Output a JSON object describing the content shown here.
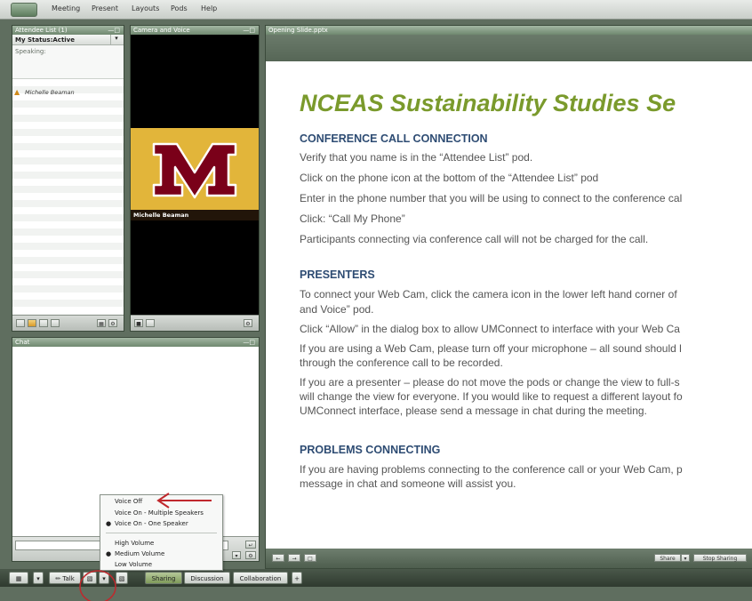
{
  "menubar": {
    "items": [
      "Meeting",
      "Present",
      "Layouts",
      "Pods",
      "Help"
    ]
  },
  "attendee_pod": {
    "title": "Attendee List (1)",
    "status": "My Status:Active",
    "speaking": "Speaking:",
    "attendees": [
      "Michelle Beaman"
    ]
  },
  "camera_pod": {
    "title": "Camera and Voice",
    "name": "Michelle Beaman"
  },
  "slide_pod": {
    "title": "Opening Slide.pptx",
    "slide_title": "NCEAS Sustainability Studies Se",
    "sections": [
      {
        "heading": "CONFERENCE CALL CONNECTION",
        "lines": [
          "Verify that you name is in the “Attendee List” pod.",
          "Click on the phone icon at the bottom of the “Attendee List” pod",
          "Enter in the phone number that you will be using to connect to the conference cal",
          "Click: “Call My Phone”",
          "Participants connecting via conference call will not be charged for the call."
        ]
      },
      {
        "heading": "PRESENTERS",
        "lines": [
          "To connect your Web Cam, click the camera icon in the lower left hand corner of",
          "and Voice” pod.",
          "Click “Allow” in the dialog box to allow UMConnect to interface with your Web Ca",
          "If you are using a Web Cam, please turn off your microphone – all sound should l",
          "through the conference call to be recorded.",
          "If you are a presenter – please do not move the pods or change the view to full-s",
          "will change the view for everyone. If you would like to request a different layout fo",
          "UMConnect interface, please send a message in chat during the meeting."
        ]
      },
      {
        "heading": "PROBLEMS CONNECTING",
        "lines": [
          "If you are having problems connecting to the conference call or your Web Cam, p",
          "message in chat and someone will assist you."
        ]
      }
    ],
    "share_label": "Share",
    "stop_sharing_label": "Stop Sharing"
  },
  "chat_pod": {
    "title": "Chat"
  },
  "voice_menu": {
    "items": [
      "Voice Off",
      "Voice On - Multiple Speakers",
      "Voice On - One Speaker",
      "High Volume",
      "Medium Volume",
      "Low Volume"
    ]
  },
  "bottombar": {
    "talk": "Talk",
    "sharing": "Sharing",
    "discussion": "Discussion",
    "collaboration": "Collaboration",
    "add": "+"
  },
  "colors": {
    "annotation_red": "#c0282d",
    "slide_title": "#7a9a2c",
    "section_heading": "#2e4c73"
  }
}
